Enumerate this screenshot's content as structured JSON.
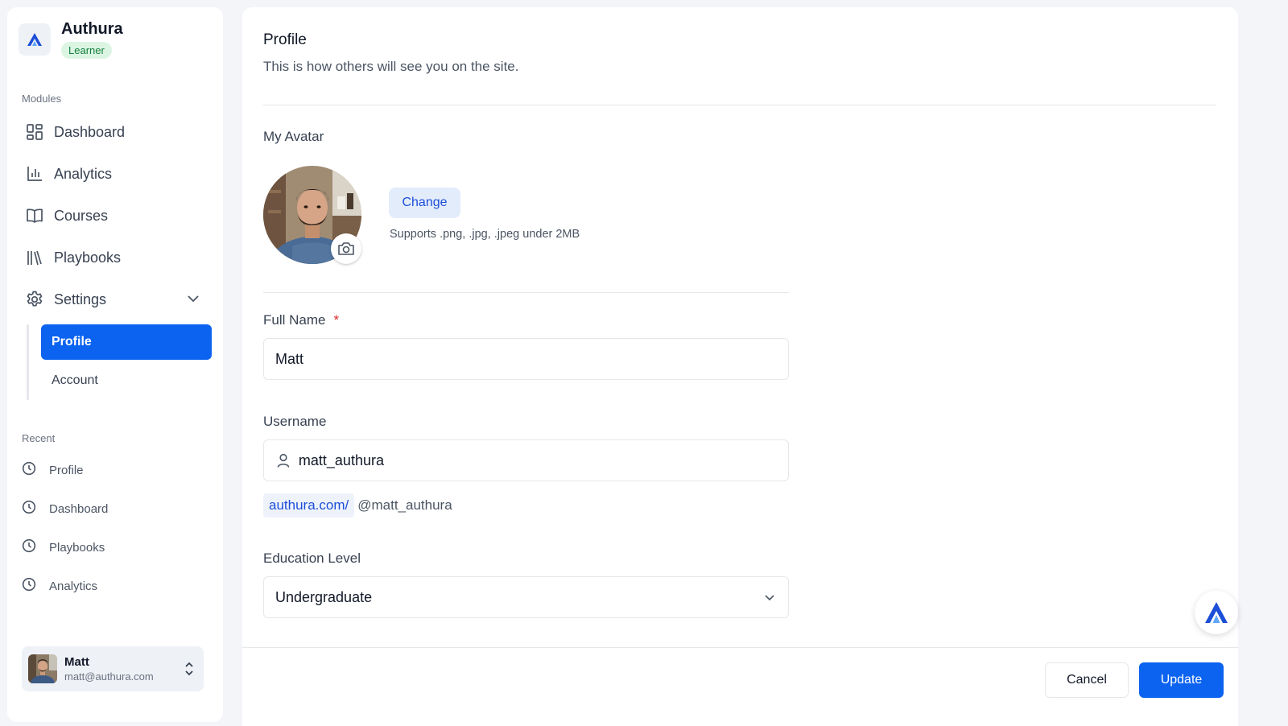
{
  "brand": {
    "name": "Authura",
    "badge": "Learner"
  },
  "sidebar": {
    "modules_label": "Modules",
    "items": [
      {
        "label": "Dashboard",
        "icon": "dashboard-icon"
      },
      {
        "label": "Analytics",
        "icon": "bar-chart-icon"
      },
      {
        "label": "Courses",
        "icon": "book-open-icon"
      },
      {
        "label": "Playbooks",
        "icon": "library-icon"
      },
      {
        "label": "Settings",
        "icon": "gear-icon"
      }
    ],
    "settings_sub": [
      {
        "label": "Profile",
        "active": true
      },
      {
        "label": "Account",
        "active": false
      }
    ],
    "recent_label": "Recent",
    "recent": [
      {
        "label": "Profile",
        "icon": "clock-icon"
      },
      {
        "label": "Dashboard",
        "icon": "clock-icon"
      },
      {
        "label": "Playbooks",
        "icon": "clock-icon"
      },
      {
        "label": "Analytics",
        "icon": "clock-icon"
      }
    ]
  },
  "user": {
    "name": "Matt",
    "email": "matt@authura.com"
  },
  "main": {
    "title": "Profile",
    "subtitle": "This is how others will see you on the site.",
    "avatar_label": "My Avatar",
    "change_label": "Change",
    "support_text": "Supports .png, .jpg, .jpeg under 2MB",
    "full_name_label": "Full Name",
    "required_mark": "*",
    "full_name_value": "Matt",
    "username_label": "Username",
    "username_value": "matt_authura",
    "url_prefix": "authura.com/",
    "url_handle": "@matt_authura",
    "education_label": "Education Level",
    "education_value": "Undergraduate",
    "cancel_label": "Cancel",
    "update_label": "Update"
  },
  "colors": {
    "accent": "#0b63f0",
    "badge_bg": "#dcf5e3",
    "badge_text": "#15803d"
  }
}
